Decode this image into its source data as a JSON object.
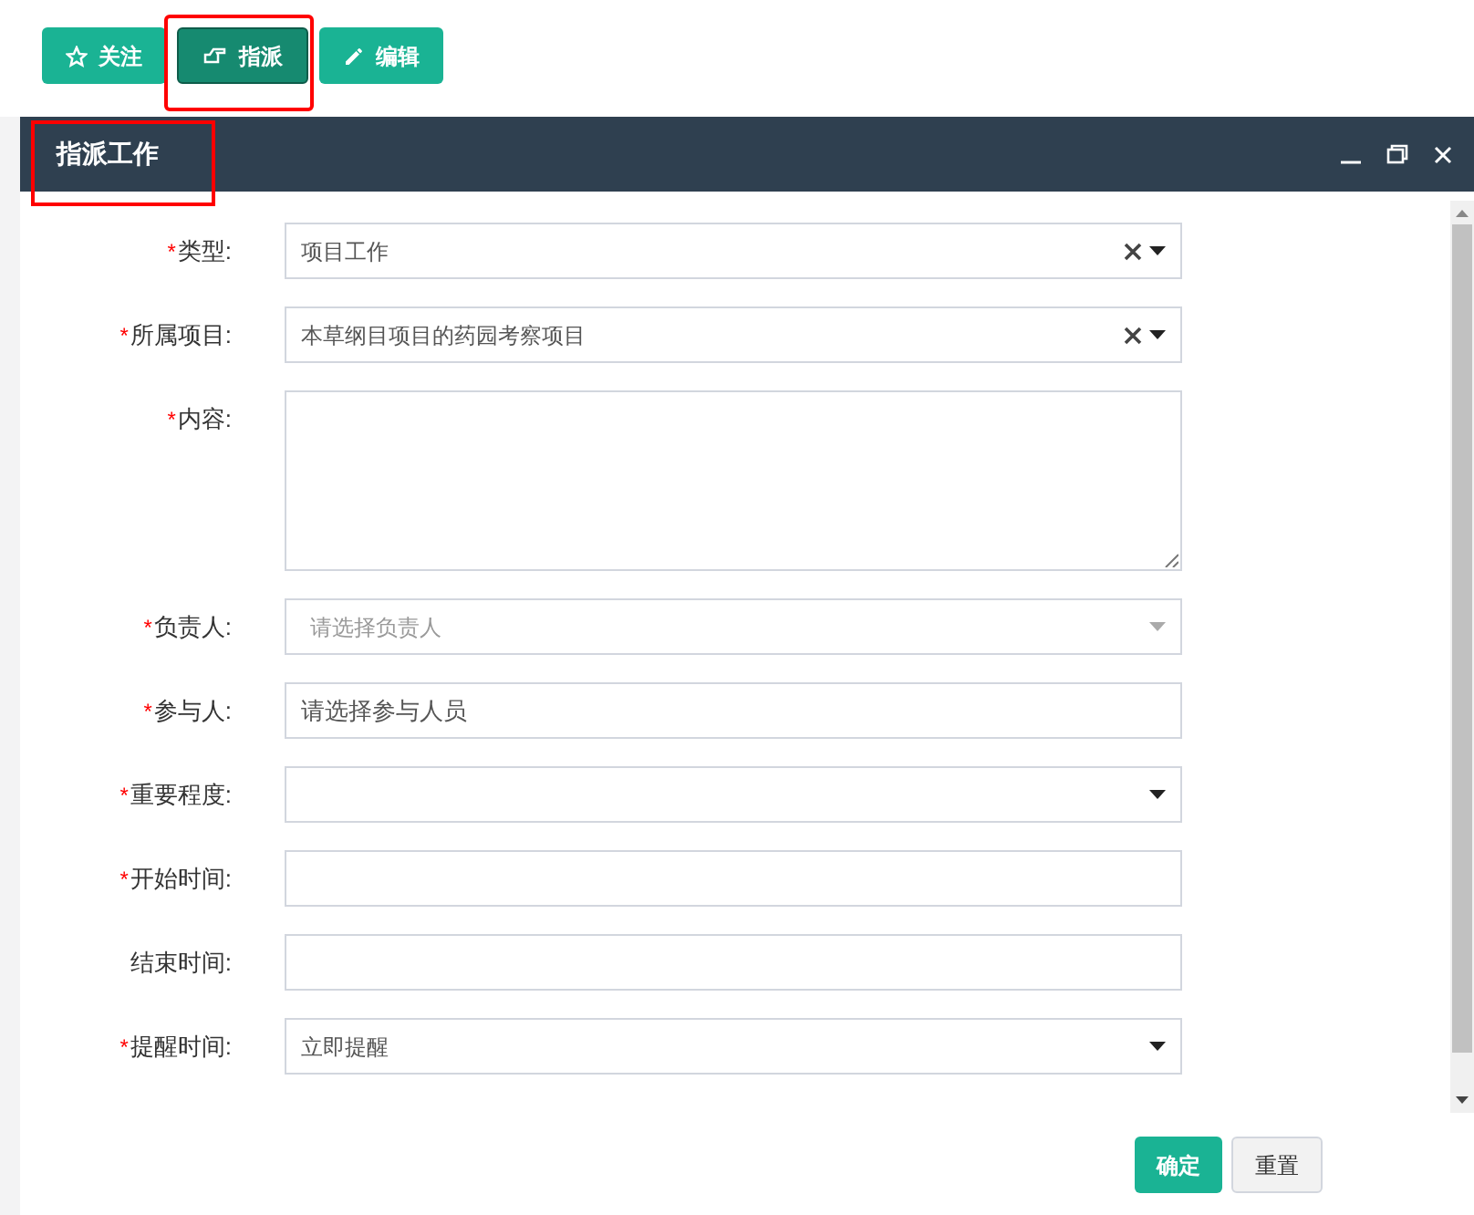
{
  "toolbar": [
    {
      "label": "关注",
      "pressed": false,
      "highlighted": false
    },
    {
      "label": "指派",
      "pressed": true,
      "highlighted": true
    },
    {
      "label": "编辑",
      "pressed": false,
      "highlighted": false
    }
  ],
  "dialog": {
    "title": "指派工作",
    "title_highlighted": true,
    "fields": [
      {
        "label": "类型:",
        "required_mark": "*",
        "kind": "select",
        "value": "项目工作",
        "clearable": true,
        "disabled": false
      },
      {
        "label": "所属项目:",
        "required_mark": "*",
        "kind": "select",
        "value": "本草纲目项目的药园考察项目",
        "clearable": true,
        "disabled": false
      },
      {
        "label": "内容:",
        "required_mark": "*",
        "kind": "textarea"
      },
      {
        "label": "负责人:",
        "required_mark": "*",
        "kind": "select",
        "placeholder": "请选择负责人",
        "clearable": false,
        "disabled": true
      },
      {
        "label": "参与人:",
        "required_mark": "*",
        "kind": "input",
        "value": "请选择参与人员"
      },
      {
        "label": "重要程度:",
        "required_mark": "*",
        "kind": "select",
        "clearable": false,
        "disabled": false
      },
      {
        "label": "开始时间:",
        "required_mark": "*",
        "kind": "input"
      },
      {
        "label": "结束时间:",
        "kind": "input"
      },
      {
        "label": "提醒时间:",
        "required_mark": "*",
        "kind": "select",
        "value": "立即提醒",
        "clearable": false,
        "disabled": false
      }
    ],
    "buttons": [
      {
        "label": "确定",
        "kind": "primary"
      },
      {
        "label": "重置",
        "kind": "default"
      }
    ]
  }
}
